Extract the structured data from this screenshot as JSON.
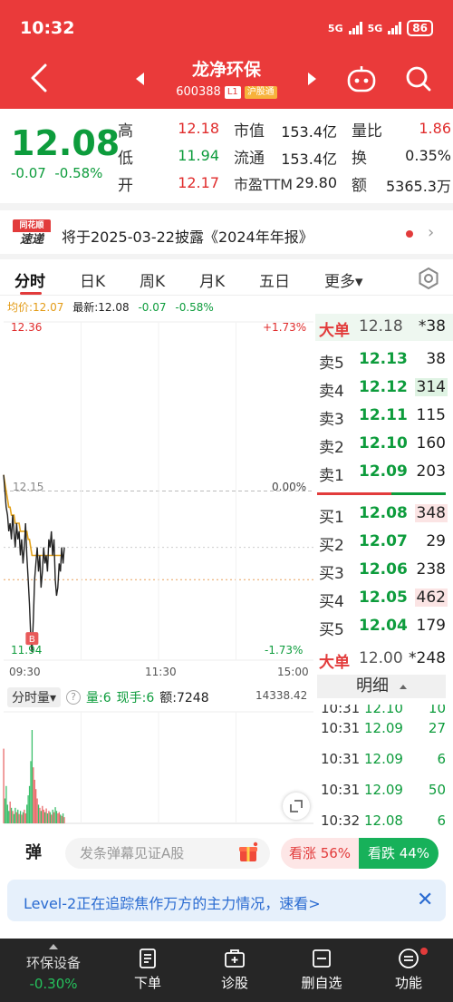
{
  "status": {
    "time": "10:32",
    "network1": "5G",
    "network2": "5G",
    "battery": "86"
  },
  "header": {
    "stock_name": "龙净环保",
    "stock_code": "600388",
    "tag_level": "L1",
    "tag_market": "沪股通"
  },
  "quote": {
    "price": "12.08",
    "change": "-0.07",
    "change_pct": "-0.58%",
    "high_label": "高",
    "high": "12.18",
    "low_label": "低",
    "low": "11.94",
    "open_label": "开",
    "open": "12.17",
    "mktcap_label": "市值",
    "mktcap": "153.4亿",
    "float_label": "流通",
    "float": "153.4亿",
    "pe_label": "市盈TTM",
    "pe": "29.80",
    "vr_label": "量比",
    "vr": "1.86",
    "turnover_label": "换",
    "turnover": "0.35%",
    "amount_label": "额",
    "amount": "5365.3万"
  },
  "notice": {
    "logo_top": "同花顺",
    "logo_bottom": "速递",
    "text": "将于2025-03-22披露《2024年年报》",
    "more": "›"
  },
  "tabs": {
    "fenshi": "分时",
    "day": "日K",
    "week": "周K",
    "month": "月K",
    "fiveday": "五日",
    "more": "更多▾"
  },
  "chart_info": {
    "avg": "均价:12.07",
    "latest": "最新:12.08",
    "chg": "-0.07",
    "chg_pct": "-0.58%"
  },
  "axes": {
    "y_top": "12.36",
    "y_mid": "12.15",
    "y_bot": "11.94",
    "pct_top": "+1.73%",
    "pct_mid": "0.00%",
    "pct_bot": "-1.73%",
    "x_start": "09:30",
    "x_mid": "11:30",
    "x_end": "15:00",
    "buy_marker": "B"
  },
  "book": {
    "big_sell_label": "大单",
    "big_sell_price": "12.18",
    "big_sell_vol": "*38",
    "asks": [
      {
        "label": "卖5",
        "price": "12.13",
        "vol": "38"
      },
      {
        "label": "卖4",
        "price": "12.12",
        "vol": "314"
      },
      {
        "label": "卖3",
        "price": "12.11",
        "vol": "115"
      },
      {
        "label": "卖2",
        "price": "12.10",
        "vol": "160"
      },
      {
        "label": "卖1",
        "price": "12.09",
        "vol": "203"
      }
    ],
    "bids": [
      {
        "label": "买1",
        "price": "12.08",
        "vol": "348"
      },
      {
        "label": "买2",
        "price": "12.07",
        "vol": "29"
      },
      {
        "label": "买3",
        "price": "12.06",
        "vol": "238"
      },
      {
        "label": "买4",
        "price": "12.05",
        "vol": "462"
      },
      {
        "label": "买5",
        "price": "12.04",
        "vol": "179"
      }
    ],
    "big_buy_label": "大单",
    "big_buy_price": "12.00",
    "big_buy_vol": "*248",
    "detail_label": "明细",
    "trades": [
      {
        "time": "10:31",
        "price": "12.10",
        "vol": "10"
      },
      {
        "time": "10:31",
        "price": "12.09",
        "vol": "27"
      },
      {
        "time": "10:31",
        "price": "12.09",
        "vol": "6"
      },
      {
        "time": "10:31",
        "price": "12.09",
        "vol": "50"
      },
      {
        "time": "10:32",
        "price": "12.08",
        "vol": "6"
      }
    ]
  },
  "volume": {
    "selector": "分时量▾",
    "help": "?",
    "vol": "量:6",
    "now": "现手:6",
    "amount": "额:7248",
    "max": "14338.42"
  },
  "danmu": {
    "icon": "弹",
    "placeholder": "发条弹幕见证A股",
    "up": "看涨 56%",
    "down": "看跌 44%"
  },
  "banner": {
    "text": "Level-2正在追踪焦作万方的主力情况，速看>",
    "close": "✕"
  },
  "nav": {
    "sector": "环保设备",
    "sector_pct": "-0.30%",
    "order": "下单",
    "diagnose": "诊股",
    "remove": "删自选",
    "functions": "功能"
  },
  "chart_data": {
    "type": "line",
    "x_range": [
      "09:30",
      "15:00"
    ],
    "ylim": [
      11.94,
      12.36
    ],
    "pre_close": 12.15,
    "series": [],
    "price": [
      12.17,
      12.15,
      12.13,
      12.12,
      12.1,
      12.11,
      12.09,
      12.12,
      12.1,
      12.08,
      12.11,
      12.09,
      12.1,
      12.07,
      12.09,
      12.06,
      12.08,
      12.11,
      12.07,
      12.04,
      12.01,
      11.97,
      11.95,
      11.99,
      12.04,
      12.06,
      12.08,
      12.05,
      12.07,
      12.03,
      12.05,
      12.08,
      12.06,
      12.07,
      12.05,
      12.09,
      12.08,
      12.1,
      12.07,
      12.09,
      12.04,
      12.02,
      12.03,
      12.06,
      12.05,
      12.08,
      12.06,
      12.08
    ],
    "avg": [
      12.17,
      12.16,
      12.15,
      12.14,
      12.13,
      12.13,
      12.12,
      12.12,
      12.12,
      12.11,
      12.11,
      12.11,
      12.11,
      12.1,
      12.1,
      12.1,
      12.1,
      12.1,
      12.1,
      12.09,
      12.09,
      12.08,
      12.07,
      12.07,
      12.07,
      12.07,
      12.07,
      12.07,
      12.07,
      12.07,
      12.07,
      12.07,
      12.07,
      12.07,
      12.07,
      12.07,
      12.07,
      12.07,
      12.07,
      12.07,
      12.07,
      12.07,
      12.07,
      12.07,
      12.07,
      12.07,
      12.07,
      12.07
    ],
    "volume": [
      120,
      40,
      60,
      30,
      20,
      35,
      25,
      20,
      15,
      25,
      18,
      22,
      15,
      20,
      14,
      18,
      22,
      16,
      30,
      45,
      60,
      100,
      150,
      90,
      70,
      55,
      40,
      30,
      25,
      20,
      28,
      22,
      18,
      24,
      16,
      20,
      18,
      14,
      22,
      18,
      26,
      20,
      16,
      18,
      14,
      12,
      16,
      10
    ]
  }
}
